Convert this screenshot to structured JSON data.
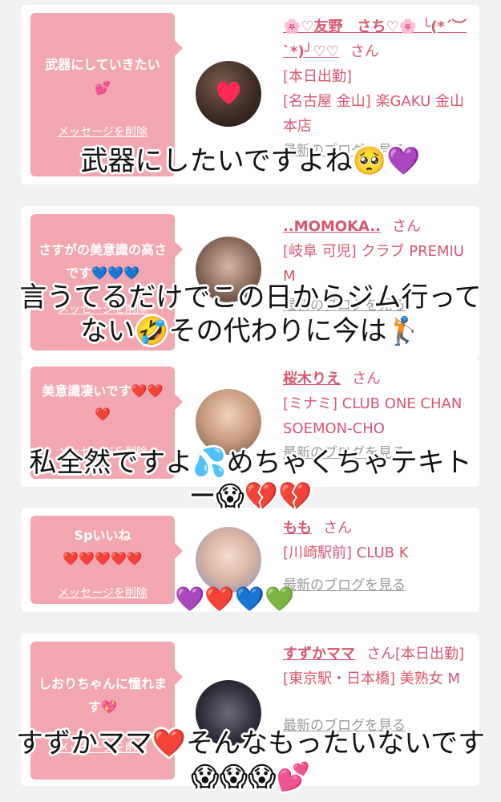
{
  "cards": [
    {
      "message": "武器にしていきたい💕",
      "delete_label": "メッセージを削除",
      "name": "🌸♡友野　さち♡🌸 ╰(*´︶`*)╯♡♡",
      "san": "さん",
      "info_lines": [
        "[本日出勤]",
        "[名古屋 金山] 楽GAKU 金山本店"
      ],
      "blog_label": "最新のブログを見る"
    },
    {
      "message": "さすがの美意識の高さです💙💙💙",
      "delete_label": "メッセージを削除",
      "name": "..MOMOKA..",
      "san": "さん",
      "info_lines": [
        "[岐阜 可児] クラブ PREMIUM"
      ],
      "blog_label": "最新のブログを見る"
    },
    {
      "message": "美意識凄いです❤️❤️❤️",
      "delete_label": "メッセージを削除",
      "name": "桜木りえ",
      "san": "さん",
      "info_lines": [
        "[ミナミ] CLUB ONE CHAN SOEMON-CHO"
      ],
      "blog_label": "最新のブログを見る"
    },
    {
      "message": "Spいいね",
      "message2": "❤️❤️❤️❤️❤️",
      "delete_label": "メッセージを削除",
      "name": "もも",
      "san": "さん",
      "info_lines": [
        "[川崎駅前] CLUB K"
      ],
      "blog_label": "最新のブログを見る"
    },
    {
      "message": "しおりちゃんに憧れます💖",
      "delete_label": "メッセージを削除",
      "name": "すずかママ",
      "san": "さん[本日出勤]",
      "info_lines": [
        "[東京駅・日本橋] 美熟女 M"
      ],
      "blog_label": "最新のブログを見る"
    }
  ],
  "captions": [
    "武器にしたいですよね🥺💜",
    "言うてるだけでこの日からジム行ってない🤣その代わりに今は🏌️",
    "私全然ですよ💦めちゃくちゃテキトー😱💔💔",
    "💜❤️💙💚",
    "すずかママ❤️そんなもったいないです😱😱😱💕"
  ]
}
